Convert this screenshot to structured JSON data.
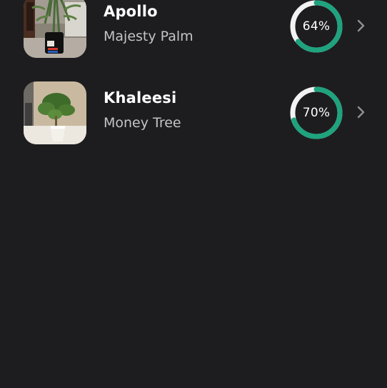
{
  "colors": {
    "background": "#1d1d1f",
    "ring_track": "#f2f2f2",
    "ring_progress": "#1fa37f",
    "chevron": "#8e8e93",
    "subtitle": "#c4c4c8"
  },
  "plants": [
    {
      "name": "Apollo",
      "species": "Majesty Palm",
      "progress": 0.64,
      "progress_label": "64%",
      "photo_icon": "plant-photo",
      "chevron_icon": "chevron-right-icon"
    },
    {
      "name": "Khaleesi",
      "species": "Money Tree",
      "progress": 0.7,
      "progress_label": "70%",
      "photo_icon": "plant-photo",
      "chevron_icon": "chevron-right-icon"
    }
  ]
}
